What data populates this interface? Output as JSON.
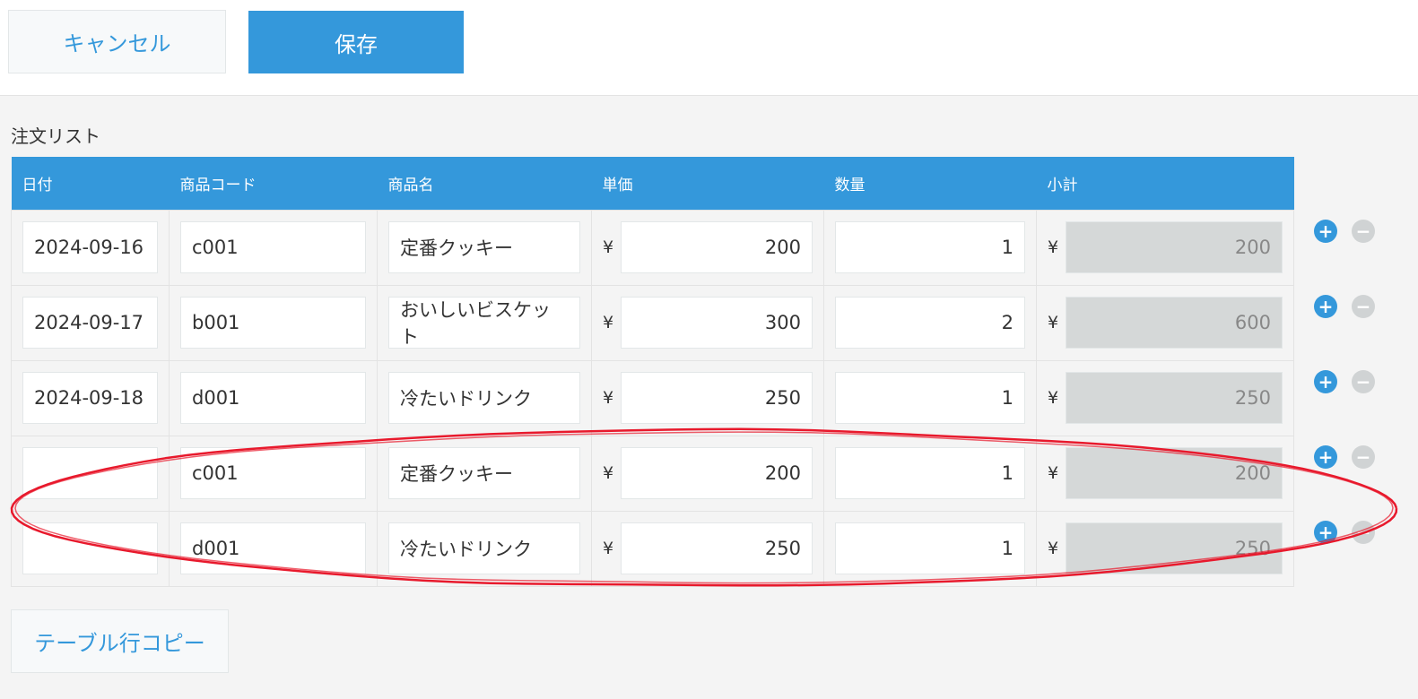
{
  "toolbar": {
    "cancel_label": "キャンセル",
    "save_label": "保存"
  },
  "list_title": "注文リスト",
  "table": {
    "headers": [
      "日付",
      "商品コード",
      "商品名",
      "単価",
      "数量",
      "小計"
    ],
    "currency_symbol": "¥",
    "rows": [
      {
        "date": "2024-09-16",
        "code": "c001",
        "name": "定番クッキー",
        "price": "200",
        "qty": "1",
        "subtotal": "200"
      },
      {
        "date": "2024-09-17",
        "code": "b001",
        "name": "おいしいビスケット",
        "price": "300",
        "qty": "2",
        "subtotal": "600"
      },
      {
        "date": "2024-09-18",
        "code": "d001",
        "name": "冷たいドリンク",
        "price": "250",
        "qty": "1",
        "subtotal": "250"
      },
      {
        "date": "",
        "code": "c001",
        "name": "定番クッキー",
        "price": "200",
        "qty": "1",
        "subtotal": "200"
      },
      {
        "date": "",
        "code": "d001",
        "name": "冷たいドリンク",
        "price": "250",
        "qty": "1",
        "subtotal": "250"
      }
    ]
  },
  "row_actions": {
    "add_icon": "+",
    "remove_icon": "−"
  },
  "copy_button_label": "テーブル行コピー",
  "colors": {
    "accent": "#3498db",
    "highlight": "#e8192c",
    "readonly_bg": "#d5d8d8"
  }
}
